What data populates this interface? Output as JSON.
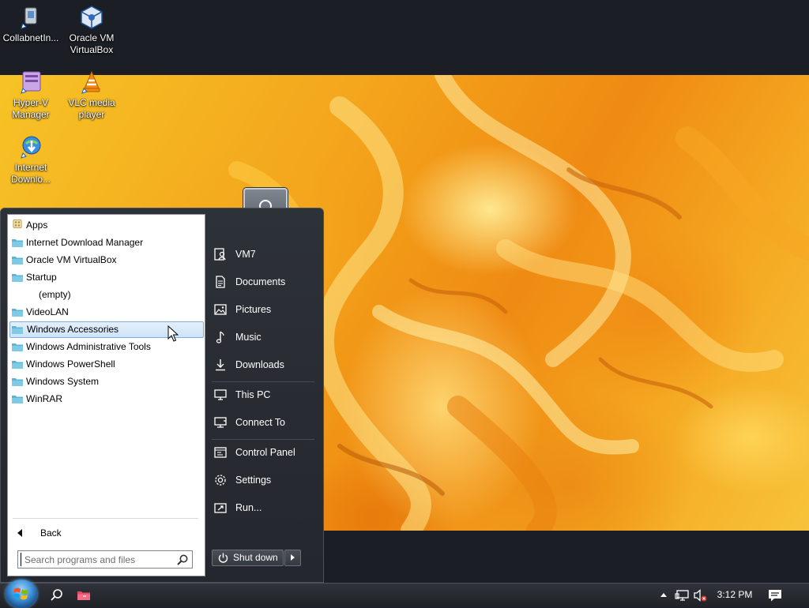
{
  "desktop": {
    "icons": [
      {
        "label": "CollabnetIn...",
        "icon": "collabnet-icon"
      },
      {
        "label": "Oracle VM VirtualBox",
        "icon": "virtualbox-icon"
      },
      {
        "label": "Hyper-V Manager",
        "icon": "hyperv-icon"
      },
      {
        "label": "VLC media player",
        "icon": "vlc-icon"
      },
      {
        "label": "Internet Downlo...",
        "icon": "idm-icon"
      }
    ]
  },
  "start_menu": {
    "programs": [
      {
        "label": "Apps",
        "icon": "apps-icon"
      },
      {
        "label": "Internet Download Manager",
        "icon": "folder-icon"
      },
      {
        "label": "Oracle VM VirtualBox",
        "icon": "folder-icon"
      },
      {
        "label": "Startup",
        "icon": "folder-icon"
      },
      {
        "label": "(empty)",
        "icon": ""
      },
      {
        "label": "VideoLAN",
        "icon": "folder-icon"
      },
      {
        "label": "Windows Accessories",
        "icon": "folder-icon",
        "selected": true
      },
      {
        "label": "Windows Administrative Tools",
        "icon": "folder-icon"
      },
      {
        "label": "Windows PowerShell",
        "icon": "folder-icon"
      },
      {
        "label": "Windows System",
        "icon": "folder-icon"
      },
      {
        "label": "WinRAR",
        "icon": "folder-icon"
      }
    ],
    "back_label": "Back",
    "search_placeholder": "Search programs and files",
    "right_items": [
      {
        "label": "VM7",
        "icon": "user-folder-icon"
      },
      {
        "label": "Documents",
        "icon": "documents-icon"
      },
      {
        "label": "Pictures",
        "icon": "pictures-icon"
      },
      {
        "label": "Music",
        "icon": "music-icon"
      },
      {
        "label": "Downloads",
        "icon": "downloads-icon"
      },
      {
        "label": "This PC",
        "icon": "this-pc-icon"
      },
      {
        "label": "Connect To",
        "icon": "connect-to-icon"
      },
      {
        "label": "Control Panel",
        "icon": "control-panel-icon"
      },
      {
        "label": "Settings",
        "icon": "settings-icon"
      },
      {
        "label": "Run...",
        "icon": "run-icon"
      }
    ],
    "shutdown_label": "Shut down"
  },
  "taskbar": {
    "clock": "3:12 PM"
  },
  "colors": {
    "accent_selection": "#cfe3f8",
    "menu_dark": "#2d3138",
    "folder": "#5fb4d6"
  }
}
